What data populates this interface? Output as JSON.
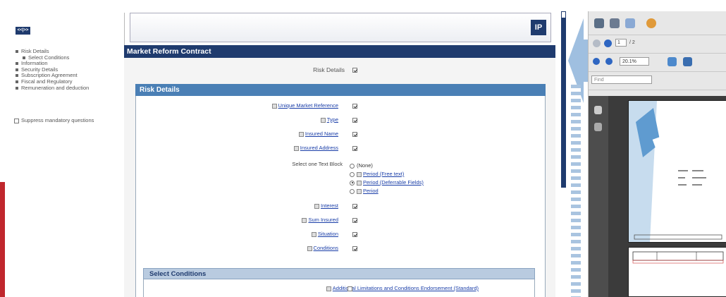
{
  "nav": {
    "toggle_label": "<<|>>",
    "items": [
      {
        "label": "Risk Details",
        "sub": false
      },
      {
        "label": "Select Conditions",
        "sub": true
      },
      {
        "label": "Information",
        "sub": false
      },
      {
        "label": "Security Details",
        "sub": false
      },
      {
        "label": "Subscription Agreement",
        "sub": false
      },
      {
        "label": "Fiscal and Regulatory",
        "sub": false
      },
      {
        "label": "Remuneration and deduction",
        "sub": false
      }
    ],
    "suppress_label": "Suppress mandatory questions"
  },
  "header": {
    "logo_text": "IP"
  },
  "form": {
    "title": "Market Reform Contract",
    "risk_details_label": "Risk Details",
    "section_title": "Risk Details",
    "fields": [
      {
        "label": "Unique Market Reference",
        "checked": true
      },
      {
        "label": "Type",
        "checked": true
      },
      {
        "label": "Insured Name",
        "checked": true
      },
      {
        "label": "Insured Address",
        "checked": true
      }
    ],
    "select_label": "Select one Text Block",
    "options": [
      {
        "label": "(None)",
        "link": false,
        "selected": false
      },
      {
        "label": "Period (Free text)",
        "link": true,
        "selected": false
      },
      {
        "label": "Period (Deferrable Fields)",
        "link": true,
        "selected": true
      },
      {
        "label": "Period",
        "link": true,
        "selected": false
      }
    ],
    "fields2": [
      {
        "label": "Interest",
        "checked": true
      },
      {
        "label": "Sum Insured",
        "checked": true
      },
      {
        "label": "Situation",
        "checked": true
      },
      {
        "label": "Conditions",
        "checked": true
      }
    ],
    "select_conditions_title": "Select Conditions",
    "condition_row": "Additional Limitations and Conditions Endorsement (Standard)"
  },
  "viewer": {
    "page_current": "1",
    "page_total": "/ 2",
    "zoom": "20.1%",
    "find_placeholder": "Find"
  },
  "colors": {
    "navy": "#1f3b6e",
    "section_blue": "#4a7fb5",
    "red_accent": "#c0272d"
  }
}
